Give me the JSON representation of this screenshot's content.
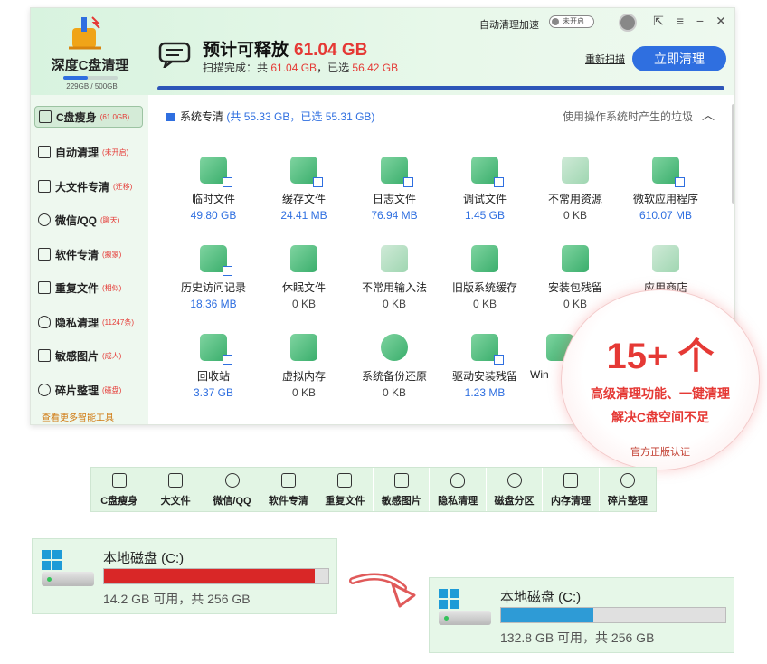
{
  "app": {
    "name": "深度C盘清理",
    "disk_mini": "229GB / 500GB",
    "auto_clean_label": "自动清理加速",
    "auto_clean_state": "未开启",
    "headline_prefix": "预计可释放",
    "headline_value": "61.04 GB",
    "scan_prefix": "扫描完成：共",
    "scan_total": "61.04 GB",
    "scan_mid": "，已选",
    "scan_selected": "56.42 GB",
    "rescan_label": "重新扫描",
    "clean_button": "立即清理",
    "accent": "#2f6fe0",
    "warn": "#e53935"
  },
  "sidebar": {
    "items": [
      {
        "label": "C盘瘦身",
        "tag": "(61.0GB)"
      },
      {
        "label": "自动清理",
        "tag": "(未开启)"
      },
      {
        "label": "大文件专清",
        "tag": "(迁移)"
      },
      {
        "label": "微信/QQ",
        "tag": "(聊天)"
      },
      {
        "label": "软件专清",
        "tag": "(搬家)"
      },
      {
        "label": "重复文件",
        "tag": "(相似)"
      },
      {
        "label": "隐私清理",
        "tag": "(11247条)"
      },
      {
        "label": "敏感图片",
        "tag": "(成人)"
      },
      {
        "label": "碎片整理",
        "tag": "(磁盘)"
      }
    ],
    "more": "查看更多智能工具"
  },
  "section": {
    "title": "系统专清",
    "stats": "(共 55.33 GB，已选 55.31 GB)",
    "hint": "使用操作系统时产生的垃圾"
  },
  "tiles": [
    {
      "name": "临时文件",
      "size": "49.80 GB"
    },
    {
      "name": "缓存文件",
      "size": "24.41 MB"
    },
    {
      "name": "日志文件",
      "size": "76.94 MB"
    },
    {
      "name": "调试文件",
      "size": "1.45 GB"
    },
    {
      "name": "不常用资源",
      "size": "0 KB"
    },
    {
      "name": "微软应用程序",
      "size": "610.07 MB"
    },
    {
      "name": "历史访问记录",
      "size": "18.36 MB"
    },
    {
      "name": "休眠文件",
      "size": "0 KB"
    },
    {
      "name": "不常用输入法",
      "size": "0 KB"
    },
    {
      "name": "旧版系统缓存",
      "size": "0 KB"
    },
    {
      "name": "安装包残留",
      "size": "0 KB"
    },
    {
      "name": "应用商店",
      "size": ""
    },
    {
      "name": "回收站",
      "size": "3.37 GB"
    },
    {
      "name": "虚拟内存",
      "size": "0 KB"
    },
    {
      "name": "系统备份还原",
      "size": "0 KB"
    },
    {
      "name": "驱动安装残留",
      "size": "1.23 MB"
    },
    {
      "name": "Win",
      "size": ""
    }
  ],
  "badge": {
    "big": "15+ 个",
    "line1": "高级清理功能、一键清理",
    "line2": "解决C盘空间不足",
    "cert": "官方正版认证"
  },
  "tools": [
    "C盘瘦身",
    "大文件",
    "微信/QQ",
    "软件专清",
    "重复文件",
    "敏感图片",
    "隐私清理",
    "磁盘分区",
    "内存清理",
    "碎片整理"
  ],
  "disk_before": {
    "name": "本地磁盘 (C:)",
    "free": "14.2 GB 可用，共 256 GB",
    "used_fraction": 0.94,
    "color": "#d92727"
  },
  "disk_after": {
    "name": "本地磁盘 (C:)",
    "free": "132.8 GB 可用，共 256 GB",
    "used_fraction": 0.41,
    "color": "#2e9bd6"
  }
}
